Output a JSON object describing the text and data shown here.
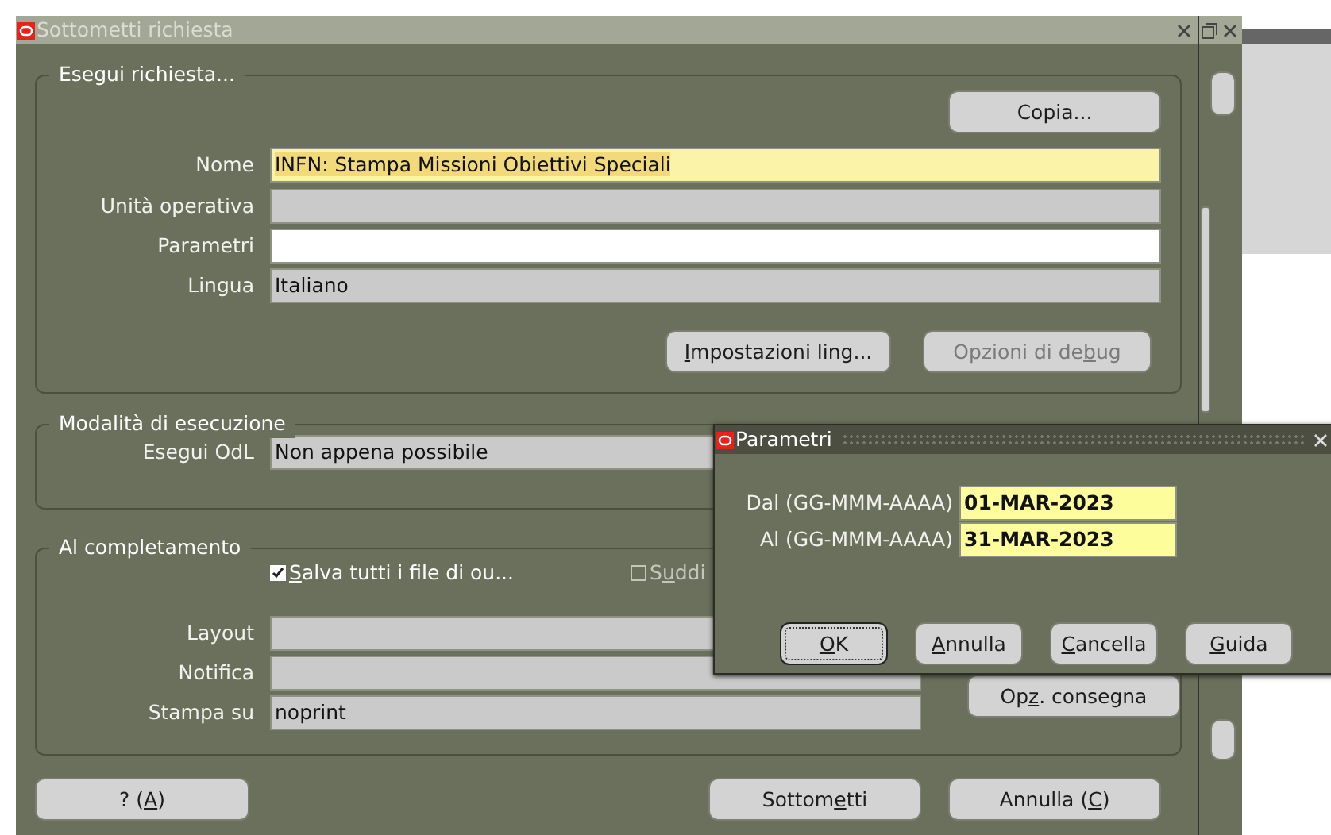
{
  "window": {
    "title": "Sottometti richiesta"
  },
  "run_request": {
    "title": "Esegui richiesta...",
    "copy_button": {
      "label": {
        "post": "Copia..."
      }
    },
    "fields": [
      {
        "label": "Nome",
        "value": "INFN: Stampa Missioni Obiettivi Speciali",
        "kind": "required",
        "text_selected": true
      },
      {
        "label": "Unità operativa",
        "kind": "readonly"
      },
      {
        "label": "Parametri",
        "kind": "editable"
      },
      {
        "label": "Lingua",
        "value": "Italiano",
        "kind": "readonly"
      }
    ],
    "buttons": [
      {
        "label": {
          "key": "I",
          "post": "mpostazioni ling..."
        },
        "disabled": false
      },
      {
        "label": {
          "pre": "Opzioni di de",
          "key": "b",
          "post": "ug"
        },
        "disabled": true
      }
    ]
  },
  "schedule": {
    "title": "Modalità di esecuzione",
    "fields": [
      {
        "label": "Esegui OdL",
        "value": "Non appena possibile"
      }
    ]
  },
  "completion": {
    "title": "Al completamento",
    "checkboxes": [
      {
        "label": {
          "key": "S",
          "post": "alva tutti i file di ou..."
        },
        "checked": true,
        "disabled": false
      },
      {
        "label": {
          "pre": "S",
          "key": "u",
          "post": "ddi"
        },
        "checked": false,
        "disabled": true
      }
    ],
    "fields": [
      {
        "label": "Layout"
      },
      {
        "label": "Notifica"
      },
      {
        "label": "Stampa su",
        "value": "noprint"
      }
    ],
    "delivery_button": {
      "label": {
        "pre": "Op",
        "key": "z",
        "post": ". consegna"
      }
    }
  },
  "footer_buttons": [
    {
      "label": {
        "pre": "? (",
        "key": "A",
        "post": ")"
      }
    },
    {
      "label": {
        "pre": "Sottom",
        "key": "e",
        "post": "tti"
      }
    },
    {
      "label": {
        "pre": "Annulla (",
        "key": "C",
        "post": ")"
      }
    }
  ],
  "dialog": {
    "title": "Parametri",
    "fields": [
      {
        "label": "Dal (GG-MMM-AAAA)",
        "value": "01-MAR-2023"
      },
      {
        "label": "Al (GG-MMM-AAAA)",
        "value": "31-MAR-2023"
      }
    ],
    "buttons": [
      {
        "label": {
          "key": "O",
          "post": "K"
        },
        "default": true
      },
      {
        "label": {
          "key": "A",
          "post": "nnulla"
        },
        "default": false
      },
      {
        "label": {
          "key": "C",
          "post": "ancella"
        },
        "default": false
      },
      {
        "label": {
          "key": "G",
          "post": "uida"
        },
        "default": false
      }
    ]
  }
}
